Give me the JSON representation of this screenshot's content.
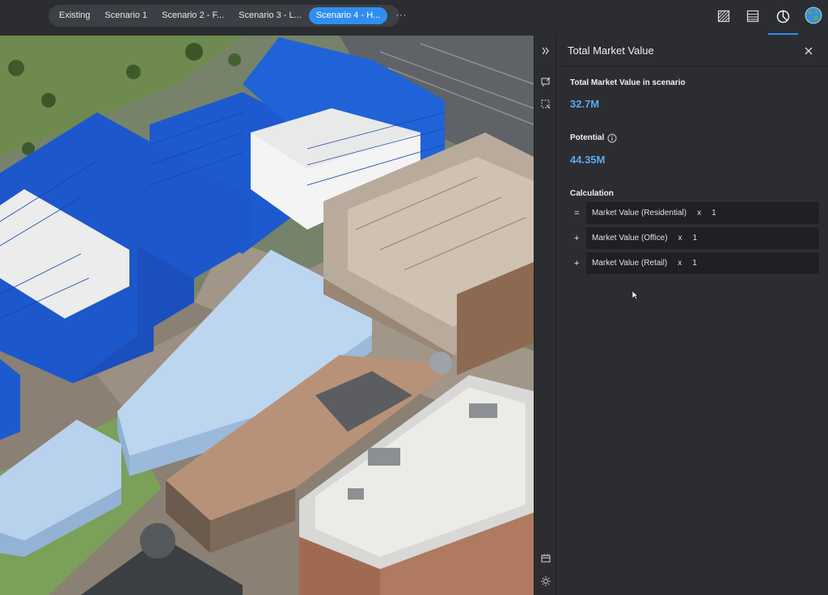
{
  "scenarios": {
    "tabs": [
      {
        "label": "Existing",
        "active": false
      },
      {
        "label": "Scenario 1",
        "active": false
      },
      {
        "label": "Scenario 2 - F...",
        "active": false
      },
      {
        "label": "Scenario 3 - L...",
        "active": false
      },
      {
        "label": "Scenario 4 - H...",
        "active": true
      }
    ],
    "more_label": "···"
  },
  "toolbar_icons": [
    "hatch-layer-icon",
    "table-icon",
    "pie-chart-icon",
    "globe-icon"
  ],
  "panel": {
    "title": "Total Market Value",
    "scenario_label": "Total Market Value in scenario",
    "scenario_value": "32.7M",
    "potential_label": "Potential",
    "potential_value": "44.35M",
    "calculation_label": "Calculation",
    "calculation": [
      {
        "op": "=",
        "term": "Market Value (Residential)",
        "x": "x",
        "multiplier": "1"
      },
      {
        "op": "+",
        "term": "Market Value (Office)",
        "x": "x",
        "multiplier": "1"
      },
      {
        "op": "+",
        "term": "Market Value (Retail)",
        "x": "x",
        "multiplier": "1"
      }
    ]
  },
  "colors": {
    "accent": "#2f8ff0",
    "value_text": "#5aaaf0",
    "building_blue": "#1f5fd6",
    "building_light": "#b8d4f0"
  }
}
